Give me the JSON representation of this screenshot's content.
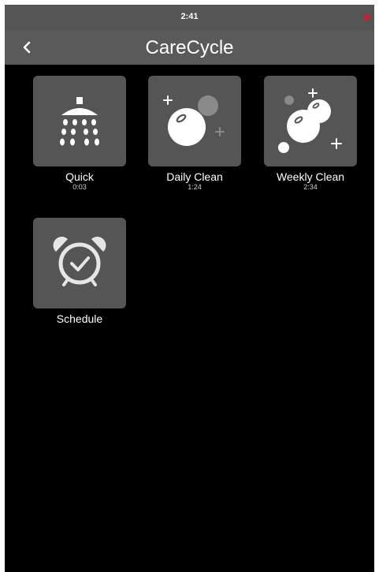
{
  "status_bar": {
    "time": "2:41"
  },
  "header": {
    "title": "CareCycle",
    "back_icon": "chevron-left-icon"
  },
  "programs": [
    {
      "label": "Quick",
      "duration": "0:03",
      "icon": "shower-head-icon"
    },
    {
      "label": "Daily Clean",
      "duration": "1:24",
      "icon": "bubbles-icon"
    },
    {
      "label": "Weekly Clean",
      "duration": "2:34",
      "icon": "bubbles-sparkle-icon"
    },
    {
      "label": "Schedule",
      "icon": "alarm-clock-icon"
    }
  ],
  "colors": {
    "background": "#000000",
    "header": "#5a5a5a",
    "tile": "#555555",
    "text": "#ffffff",
    "status_dot": "#c8202c"
  }
}
